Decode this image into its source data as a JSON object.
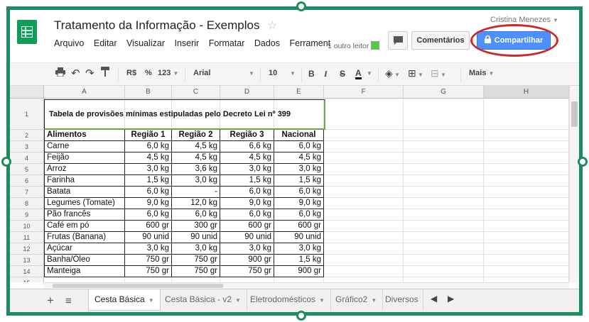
{
  "app": {
    "doc_title": "Tratamento da Informação - Exemplos",
    "user_name": "Cristina Menezes",
    "menu": [
      "Arquivo",
      "Editar",
      "Visualizar",
      "Inserir",
      "Formatar",
      "Dados",
      "Ferrament"
    ],
    "viewers_text": "1 outro leitor",
    "comments_label": "Comentários",
    "share_label": "Compartilhar"
  },
  "toolbar": {
    "currency": "R$",
    "percent": "%",
    "number_format": "123",
    "font": "Arial",
    "font_size": "10",
    "bold": "B",
    "italic": "I",
    "strike": "S",
    "text_color": "A",
    "more": "Mais"
  },
  "columns": [
    "A",
    "B",
    "C",
    "D",
    "E",
    "F",
    "G",
    "H"
  ],
  "rows": [
    "1",
    "2",
    "3",
    "4",
    "5",
    "6",
    "7",
    "8",
    "9",
    "10",
    "11",
    "12",
    "13",
    "14",
    "15"
  ],
  "table": {
    "title": "Tabela de provisões mínimas estipuladas pelo Decreto Lei nº 399",
    "headers": [
      "Alimentos",
      "Região 1",
      "Região 2",
      "Região 3",
      "Nacional"
    ],
    "data": [
      [
        "Carne",
        "6,0 kg",
        "4,5 kg",
        "6,6 kg",
        "6,0 kg"
      ],
      [
        "Feijão",
        "4,5 kg",
        "4,5 kg",
        "4,5 kg",
        "4,5 kg"
      ],
      [
        "Arroz",
        "3,0 kg",
        "3,6 kg",
        "3,0 kg",
        "3,0 kg"
      ],
      [
        "Farinha",
        "1,5 kg",
        "3,0 kg",
        "1,5 kg",
        "1,5 kg"
      ],
      [
        "Batata",
        "6,0 kg",
        "-",
        "6,0 kg",
        "6,0 kg"
      ],
      [
        "Legumes (Tomate)",
        "9,0 kg",
        "12,0 kg",
        "9,0 kg",
        "9,0 kg"
      ],
      [
        "Pão francês",
        "6,0 kg",
        "6,0 kg",
        "6,0 kg",
        "6,0 kg"
      ],
      [
        "Café em pó",
        "600 gr",
        "300 gr",
        "600 gr",
        "600 gr"
      ],
      [
        "Frutas (Banana)",
        "90 unid",
        "90 unid",
        "90 unid",
        "90 unid"
      ],
      [
        "Açúcar",
        "3,0 kg",
        "3,0 kg",
        "3,0 kg",
        "3,0 kg"
      ],
      [
        "Banha/Óleo",
        "750 gr",
        "750 gr",
        "900 gr",
        "1,5 kg"
      ],
      [
        "Manteiga",
        "750 gr",
        "750 gr",
        "750 gr",
        "900 gr"
      ]
    ]
  },
  "sheets": [
    "Cesta Básica",
    "Cesta Básica - v2",
    "Eletrodomésticos",
    "Gráfico2",
    "Diversos"
  ],
  "colors": {
    "frame": "#1f8b5e",
    "share": "#4d90fe",
    "highlight": "#cc2a2a",
    "logo": "#0f9d58"
  }
}
